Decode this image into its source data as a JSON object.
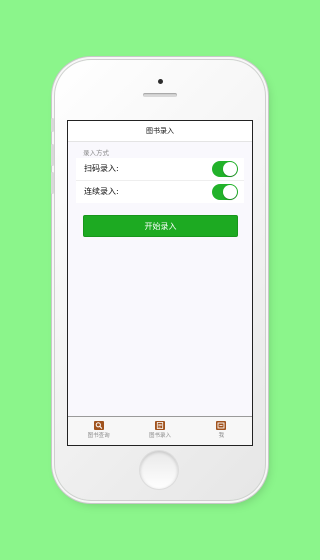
{
  "nav": {
    "title": "图书录入"
  },
  "entry_section": {
    "header": "录入方式",
    "rows": [
      {
        "label": "扫码录入:",
        "toggle_on": true
      },
      {
        "label": "连续录入:",
        "toggle_on": true
      }
    ]
  },
  "start_button": {
    "label": "开始录入"
  },
  "tabs": [
    {
      "label": "图书查询",
      "icon": "search-icon"
    },
    {
      "label": "图书录入",
      "icon": "edit-icon"
    },
    {
      "label": "我",
      "icon": "profile-icon"
    }
  ],
  "colors": {
    "background": "#8bf58b",
    "accent_green": "#1daa22",
    "tab_icon": "#a0521d"
  }
}
